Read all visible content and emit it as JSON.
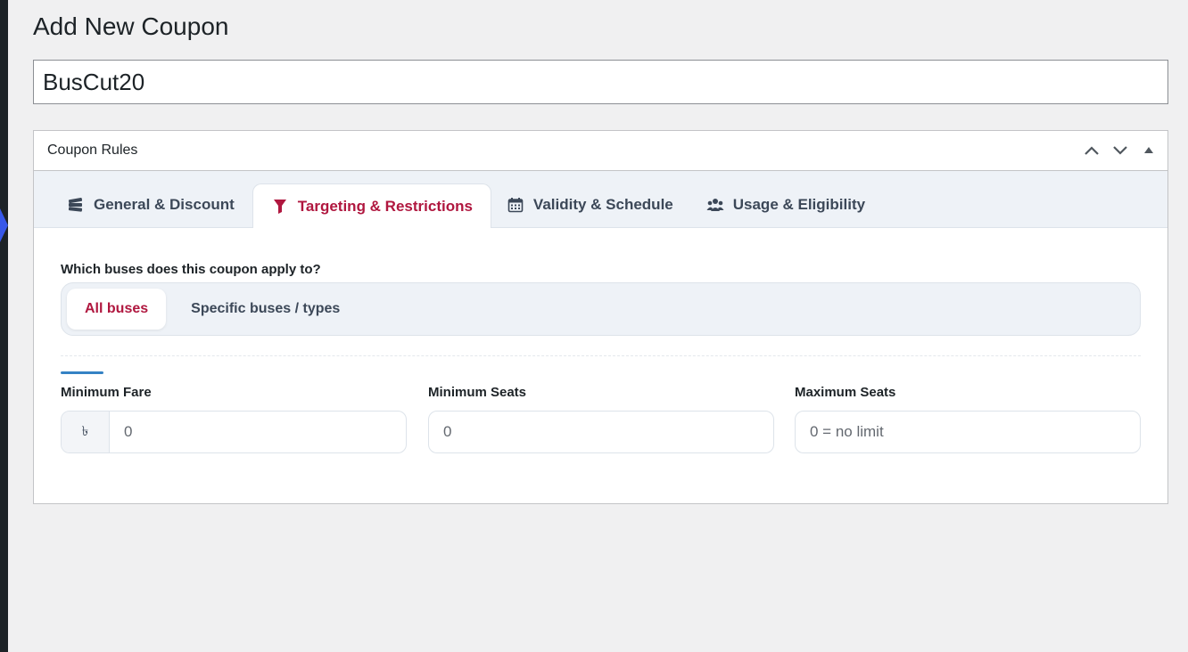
{
  "page": {
    "title": "Add New Coupon",
    "coupon_code": "BusCut20"
  },
  "metabox": {
    "title": "Coupon Rules",
    "controls": [
      "chevron-up-icon",
      "chevron-down-icon",
      "toggle-triangle-icon"
    ]
  },
  "tabs": [
    {
      "label": "General & Discount",
      "icon": "ticket-stack-icon",
      "active": false
    },
    {
      "label": "Targeting & Restrictions",
      "icon": "filter-icon",
      "active": true
    },
    {
      "label": "Validity & Schedule",
      "icon": "calendar-icon",
      "active": false
    },
    {
      "label": "Usage & Eligibility",
      "icon": "users-icon",
      "active": false
    }
  ],
  "targeting": {
    "question": "Which buses does this coupon apply to?",
    "options": [
      {
        "label": "All buses",
        "active": true
      },
      {
        "label": "Specific buses / types",
        "active": false
      }
    ]
  },
  "fields": {
    "min_fare": {
      "label": "Minimum Fare",
      "prefix": "৳",
      "placeholder": "0"
    },
    "min_seats": {
      "label": "Minimum Seats",
      "placeholder": "0"
    },
    "max_seats": {
      "label": "Maximum Seats",
      "placeholder": "0 = no limit"
    }
  },
  "colors": {
    "accent": "#b0173f",
    "admin_blue": "#3858e9",
    "divider_accent": "#3582c4"
  }
}
